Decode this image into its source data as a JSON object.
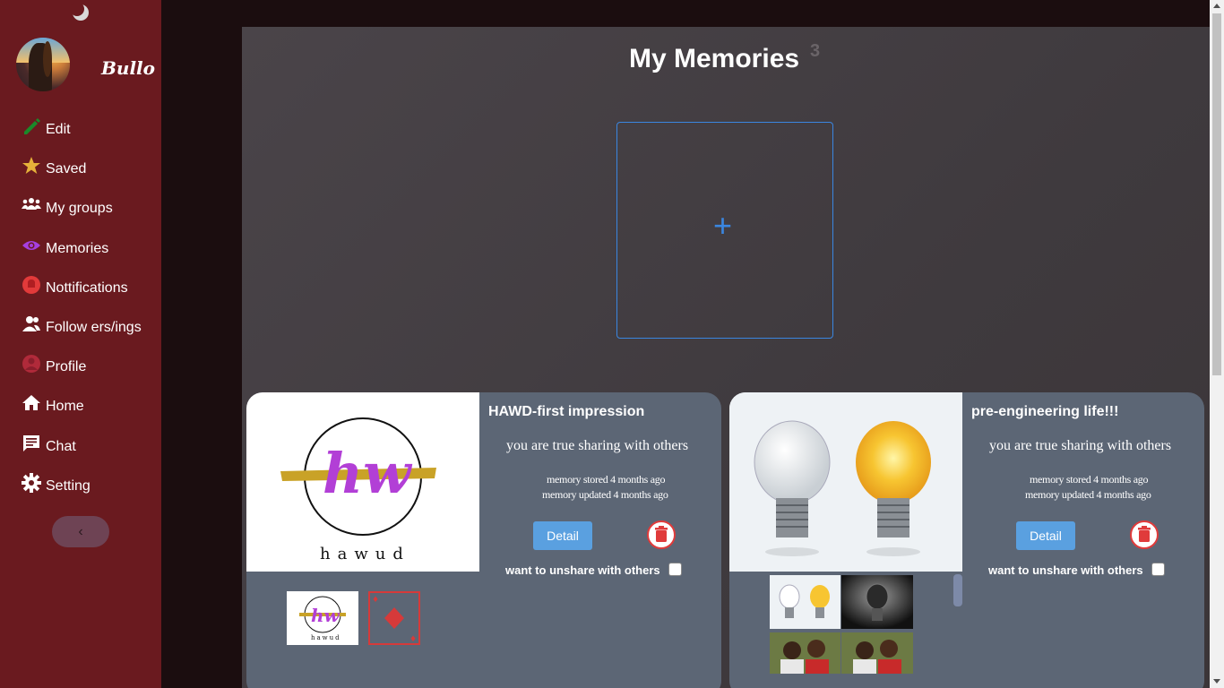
{
  "sidebar": {
    "username": "Bullo",
    "items": [
      {
        "label": "Edit",
        "icon": "pencil-icon",
        "color": "#1a8a2a"
      },
      {
        "label": "Saved",
        "icon": "star-icon",
        "color": "#e6b23a"
      },
      {
        "label": "My groups",
        "icon": "group-icon",
        "color": "#ffffff"
      },
      {
        "label": "Memories",
        "icon": "eye-icon",
        "color": "#a63fe0"
      },
      {
        "label": "Nottifications",
        "icon": "bell-icon",
        "color": "#e23a3a"
      },
      {
        "label": "Follow ers/ings",
        "icon": "people-icon",
        "color": "#ffffff"
      },
      {
        "label": "Profile",
        "icon": "user-icon",
        "color": "#b02a3a"
      },
      {
        "label": "Home",
        "icon": "home-icon",
        "color": "#ffffff"
      },
      {
        "label": "Chat",
        "icon": "chat-icon",
        "color": "#ffffff"
      },
      {
        "label": "Setting",
        "icon": "gear-icon",
        "color": "#ffffff"
      }
    ],
    "collapse_label": "‹"
  },
  "main": {
    "title": "My Memories",
    "count": "3",
    "add_label": "+"
  },
  "cards": [
    {
      "title": "HAWD-first impression",
      "share_msg": "you are true sharing with others",
      "stored": "memory stored 4 months ago",
      "updated": "memory updated 4 months ago",
      "detail_label": "Detail",
      "unshare_label": "want to unshare with others",
      "logo_text": "hawud"
    },
    {
      "title": "pre-engineering life!!!",
      "share_msg": "you are true sharing with others",
      "stored": "memory stored 4 months ago",
      "updated": "memory updated 4 months ago",
      "detail_label": "Detail",
      "unshare_label": "want to unshare with others"
    }
  ]
}
